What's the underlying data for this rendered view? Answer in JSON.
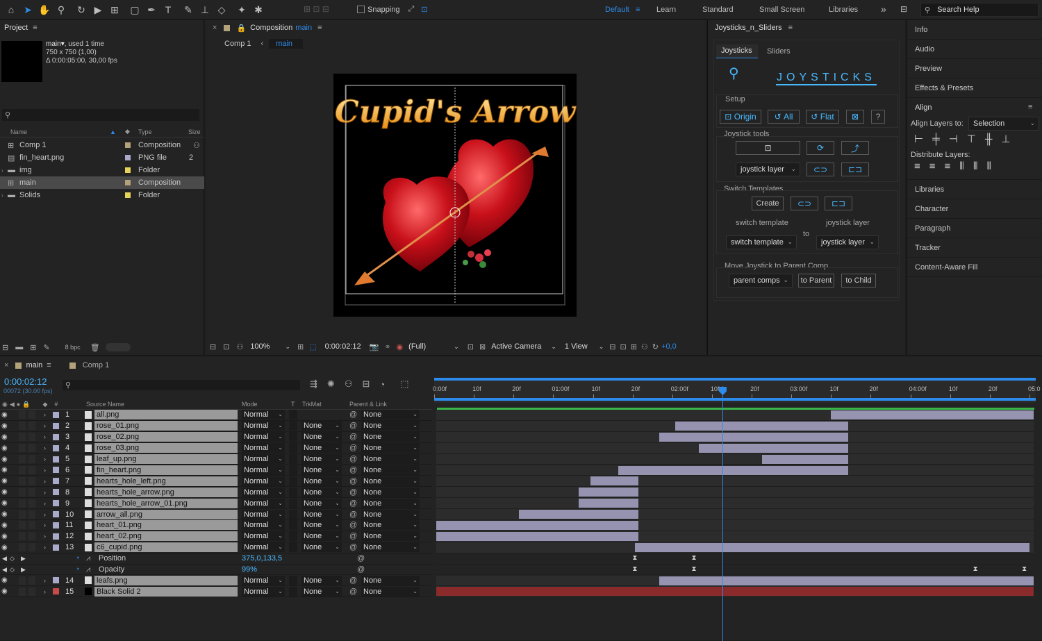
{
  "toolbar": {
    "snapping": "Snapping",
    "workspaces": [
      "Default",
      "Learn",
      "Standard",
      "Small Screen",
      "Libraries"
    ],
    "search_placeholder": "Search Help"
  },
  "project": {
    "title": "Project",
    "selected_name": "main",
    "used": ", used 1 time",
    "dimensions": "750 x 750  (1,00)",
    "duration": "Δ 0:00:05:00, 30,00 fps",
    "columns": {
      "name": "Name",
      "type": "Type",
      "size": "Size"
    },
    "items": [
      {
        "name": "Comp 1",
        "type": "Composition",
        "size": "",
        "color": "#b3a27a"
      },
      {
        "name": "fin_heart.png",
        "type": "PNG file",
        "size": "2",
        "color": "#a9a9c9"
      },
      {
        "name": "img",
        "type": "Folder",
        "size": "",
        "color": "#e6d35a"
      },
      {
        "name": "main",
        "type": "Composition",
        "size": "",
        "color": "#b3a27a"
      },
      {
        "name": "Solids",
        "type": "Folder",
        "size": "",
        "color": "#e6d35a"
      }
    ],
    "bpc": "8 bpc"
  },
  "comp": {
    "title": "Composition",
    "title_name": "main",
    "breadcrumbs": [
      "Comp 1",
      "main"
    ],
    "headline": "Cupid's Arrow",
    "zoom": "100%",
    "timecode": "0:00:02:12",
    "resolution": "(Full)",
    "camera": "Active Camera",
    "view": "1 View",
    "exposure": "+0,0"
  },
  "joy": {
    "title": "Joysticks_n_Sliders",
    "tabs": [
      "Joysticks",
      "Sliders"
    ],
    "logo_text": "JOYSTICKS",
    "setup": "Setup",
    "origin": "Origin",
    "all": "All",
    "flat": "Flat",
    "help": "?",
    "joystick_tools": "Joystick tools",
    "joystick_layer_dd": "joystick layer",
    "switch_templates": "Switch Templates",
    "create": "Create",
    "switch_template_label": "switch template",
    "joystick_layer_label": "joystick layer",
    "to": "to",
    "switch_template_dd": "switch template",
    "joystick_layer_dd2": "joystick layer",
    "move_joystick": "Move Joystick to Parent Comp",
    "parent_comps": "parent comps",
    "to_parent": "to Parent",
    "to_child": "to Child"
  },
  "right": {
    "items_top": [
      "Info",
      "Audio",
      "Preview",
      "Effects & Presets"
    ],
    "align_title": "Align",
    "align_layers_to": "Align Layers to:",
    "align_select": "Selection",
    "distribute": "Distribute Layers:",
    "items_bottom": [
      "Libraries",
      "Character",
      "Paragraph",
      "Tracker",
      "Content-Aware Fill"
    ]
  },
  "timeline": {
    "tabs": [
      "main",
      "Comp 1"
    ],
    "timecode": "0:00:02:12",
    "frames": "00072 (30.00 fps)",
    "columns": {
      "source": "Source Name",
      "mode": "Mode",
      "t": "T",
      "trkmat": "TrkMat",
      "parent": "Parent & Link"
    },
    "ruler": [
      "0:00f",
      "10f",
      "20f",
      "01:00f",
      "10f",
      "20f",
      "02:00f",
      "10f",
      "20f",
      "03:00f",
      "10f",
      "20f",
      "04:00f",
      "10f",
      "20f",
      "05:0"
    ],
    "playhead": 0.479,
    "layers": [
      {
        "num": "1",
        "name": "all.png",
        "mode": "Normal",
        "trkmat": "",
        "parent": "None",
        "color": "#a9a9c9",
        "start": 0.66,
        "end": 1.0
      },
      {
        "num": "2",
        "name": "rose_01.png",
        "mode": "Normal",
        "trkmat": "None",
        "parent": "None",
        "color": "#a9a9c9",
        "start": 0.4,
        "end": 0.69
      },
      {
        "num": "3",
        "name": "rose_02.png",
        "mode": "Normal",
        "trkmat": "None",
        "parent": "None",
        "color": "#a9a9c9",
        "start": 0.373,
        "end": 0.69
      },
      {
        "num": "4",
        "name": "rose_03.png",
        "mode": "Normal",
        "trkmat": "None",
        "parent": "None",
        "color": "#a9a9c9",
        "start": 0.44,
        "end": 0.69
      },
      {
        "num": "5",
        "name": "leaf_up.png",
        "mode": "Normal",
        "trkmat": "None",
        "parent": "None",
        "color": "#a9a9c9",
        "start": 0.545,
        "end": 0.69
      },
      {
        "num": "6",
        "name": "fin_heart.png",
        "mode": "Normal",
        "trkmat": "None",
        "parent": "None",
        "color": "#a9a9c9",
        "start": 0.305,
        "end": 0.69
      },
      {
        "num": "7",
        "name": "hearts_hole_left.png",
        "mode": "Normal",
        "trkmat": "None",
        "parent": "None",
        "color": "#a9a9c9",
        "start": 0.258,
        "end": 0.338
      },
      {
        "num": "8",
        "name": "hearts_hole_arrow.png",
        "mode": "Normal",
        "trkmat": "None",
        "parent": "None",
        "color": "#a9a9c9",
        "start": 0.238,
        "end": 0.338
      },
      {
        "num": "9",
        "name": "hearts_hole_arrow_01.png",
        "mode": "Normal",
        "trkmat": "None",
        "parent": "None",
        "color": "#a9a9c9",
        "start": 0.238,
        "end": 0.338
      },
      {
        "num": "10",
        "name": "arrow_all.png",
        "mode": "Normal",
        "trkmat": "None",
        "parent": "None",
        "color": "#a9a9c9",
        "start": 0.138,
        "end": 0.338
      },
      {
        "num": "11",
        "name": "heart_01.png",
        "mode": "Normal",
        "trkmat": "None",
        "parent": "None",
        "color": "#a9a9c9",
        "start": 0.0,
        "end": 0.338
      },
      {
        "num": "12",
        "name": "heart_02.png",
        "mode": "Normal",
        "trkmat": "None",
        "parent": "None",
        "color": "#a9a9c9",
        "start": 0.0,
        "end": 0.338
      },
      {
        "num": "13",
        "name": "c6_cupid.png",
        "mode": "Normal",
        "trkmat": "None",
        "parent": "None",
        "color": "#a9a9c9",
        "start": 0.333,
        "end": 0.993
      }
    ],
    "props": [
      {
        "name": "Position",
        "value": "375,0,133,5"
      },
      {
        "name": "Opacity",
        "value": "99%"
      }
    ],
    "layers_bottom": [
      {
        "num": "14",
        "name": "leafs.png",
        "mode": "Normal",
        "trkmat": "None",
        "parent": "None",
        "color": "#a9a9c9",
        "start": 0.373,
        "end": 1.0
      },
      {
        "num": "15",
        "name": "Black Solid 2",
        "mode": "Normal",
        "trkmat": "None",
        "parent": "None",
        "color": "#c94a4a",
        "start": 0.0,
        "end": 1.0
      }
    ]
  }
}
